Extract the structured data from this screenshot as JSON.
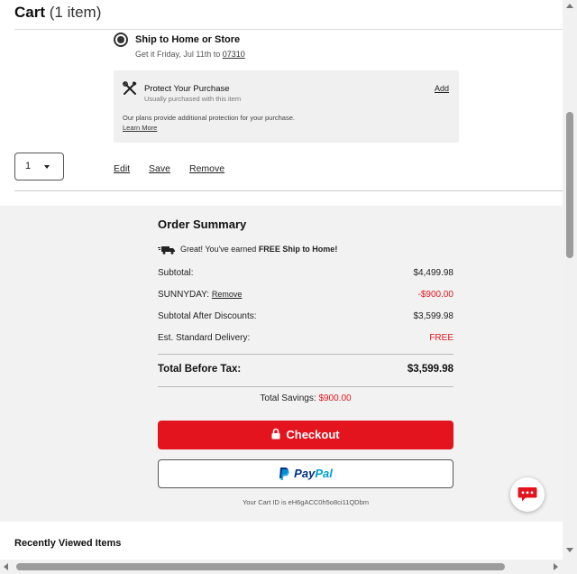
{
  "cart": {
    "title": "Cart",
    "count_label": "(1 item)"
  },
  "shipping": {
    "option_label": "Ship to Home or Store",
    "eta_prefix": "Get it Friday, Jul 11th to",
    "zip": "07310"
  },
  "protection": {
    "icon": "tools-icon",
    "title": "Protect Your Purchase",
    "subtitle": "Usually purchased with this item",
    "add_label": "Add",
    "description": "Our plans provide additional protection for your purchase.",
    "learn_more": "Learn More"
  },
  "item": {
    "quantity": "1",
    "actions": {
      "edit": "Edit",
      "save": "Save",
      "remove": "Remove"
    }
  },
  "summary": {
    "title": "Order Summary",
    "free_ship_prefix": "Great! You've earned",
    "free_ship_bold": "FREE Ship to Home!",
    "subtotal_label": "Subtotal:",
    "subtotal_value": "$4,499.98",
    "promo_code": "SUNNYDAY:",
    "promo_remove": "Remove",
    "promo_value": "-$900.00",
    "after_discounts_label": "Subtotal After Discounts:",
    "after_discounts_value": "$3,599.98",
    "delivery_label": "Est. Standard Delivery:",
    "delivery_value": "FREE",
    "total_label": "Total Before Tax:",
    "total_value": "$3,599.98",
    "savings_label": "Total Savings:",
    "savings_value": "$900.00",
    "checkout_label": "Checkout",
    "paypal_part1": "Pay",
    "paypal_part2": "Pal",
    "cart_id_label": "Your Cart ID is eH6gACC0h5o8ci11QDbm"
  },
  "recent": {
    "title": "Recently Viewed Items"
  },
  "colors": {
    "accent_red": "#e3141e",
    "paypal_dark": "#003087",
    "paypal_light": "#009cde",
    "summary_bg": "#f2f2f2"
  }
}
